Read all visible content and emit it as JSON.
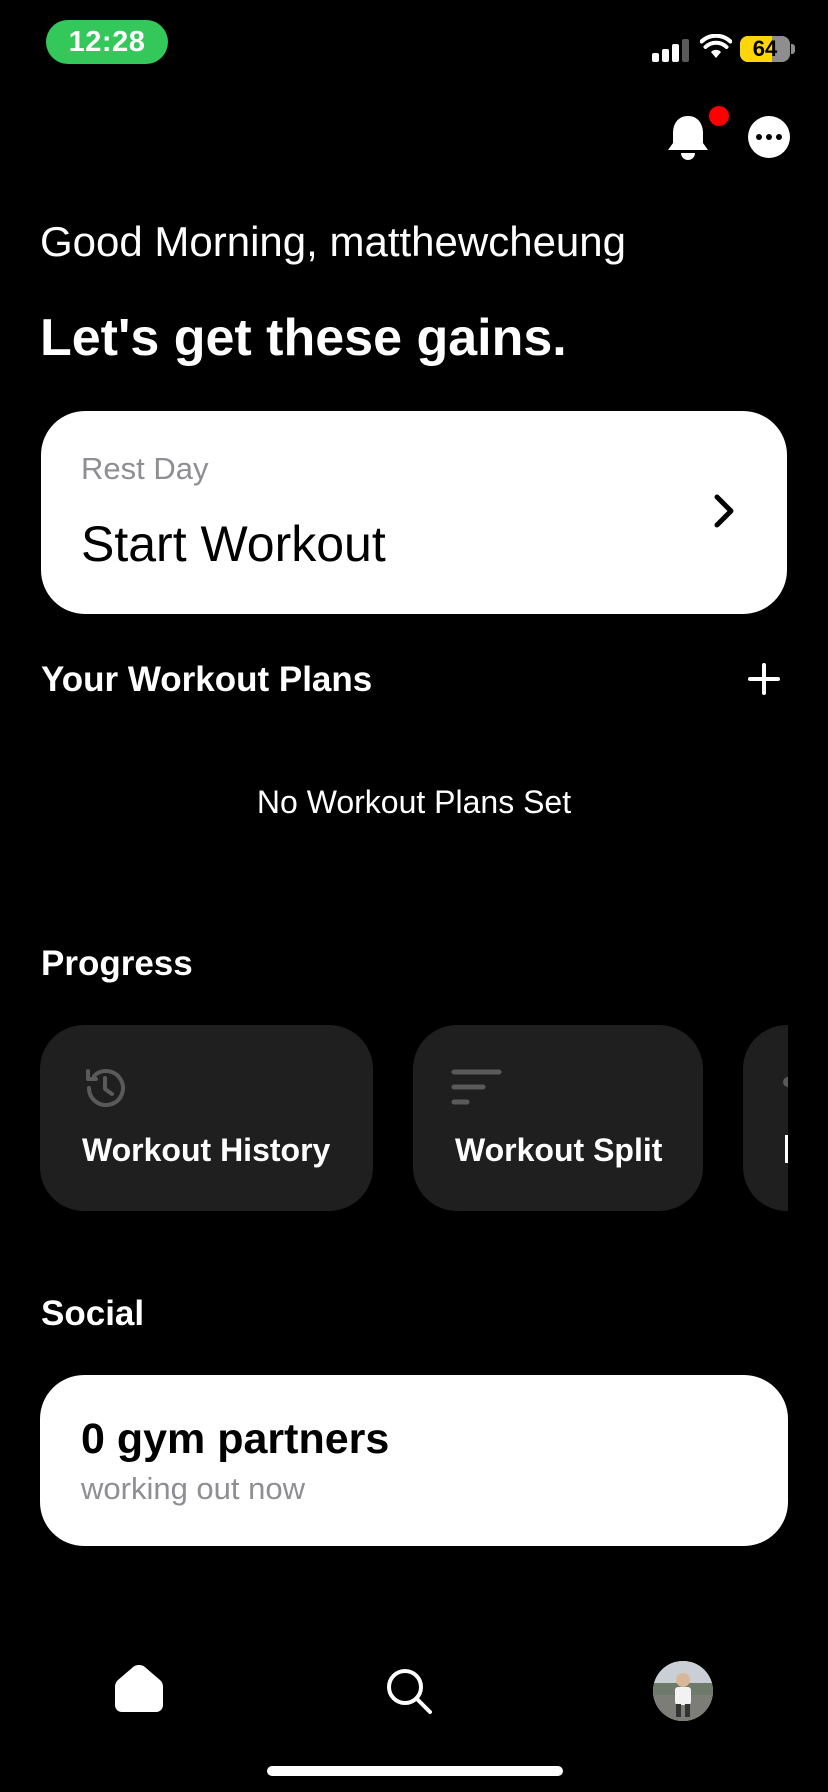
{
  "status_bar": {
    "time": "12:28",
    "battery_level": "64",
    "battery_fraction": 0.64,
    "colors": {
      "time_pill": "#34c759",
      "battery": "#ffd60a"
    },
    "icons": [
      "cellular-signal-icon",
      "wifi-icon",
      "battery-icon"
    ]
  },
  "header": {
    "icons": [
      "bell-icon",
      "more-icon"
    ],
    "notification_dot_color": "#ff0000"
  },
  "greeting": "Good Morning, matthewcheung",
  "headline": "Let's get these gains.",
  "start_card": {
    "subtitle": "Rest Day",
    "title": "Start Workout",
    "icon": "chevron-right-icon"
  },
  "workout_plans": {
    "title": "Your Workout Plans",
    "add_icon": "plus-icon",
    "empty_message": "No Workout Plans Set"
  },
  "progress": {
    "title": "Progress",
    "tiles": [
      {
        "label": "Workout History",
        "icon": "history-icon"
      },
      {
        "label": "Workout Split",
        "icon": "sort-lines-icon"
      }
    ]
  },
  "social": {
    "title": "Social",
    "count_text": "0 gym partners",
    "subtitle": "working out now"
  },
  "tab_bar": {
    "items": [
      "home-icon",
      "search-icon",
      "profile-avatar"
    ]
  }
}
